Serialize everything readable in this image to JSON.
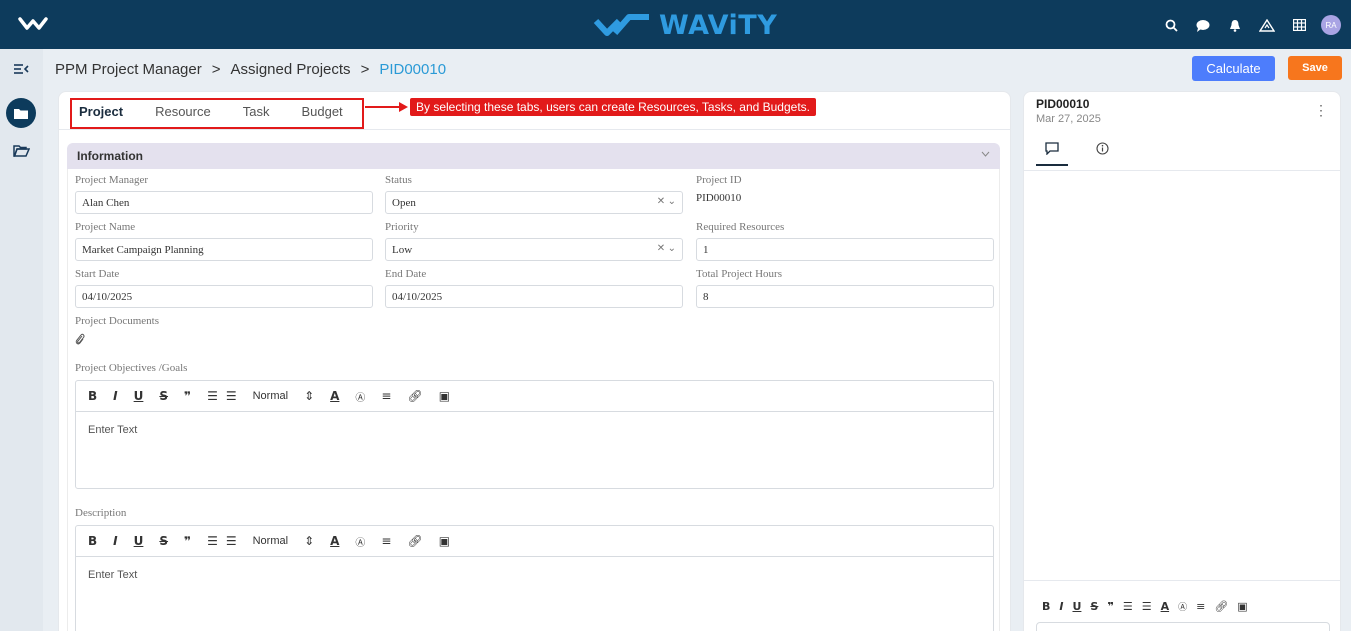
{
  "topbar": {
    "brand": "WAViTY",
    "avatar": "RA",
    "icons": [
      "search-icon",
      "chat-icon",
      "bell-icon",
      "triangle-logo-icon",
      "grid-icon"
    ]
  },
  "breadcrumb": {
    "items": [
      "PPM Project Manager",
      "Assigned Projects",
      "PID00010"
    ],
    "separator": ">"
  },
  "actions": {
    "calculate": "Calculate",
    "save": "Save"
  },
  "tabs": [
    "Project",
    "Resource",
    "Task",
    "Budget"
  ],
  "callout": "By selecting these tabs, users can create Resources, Tasks, and Budgets.",
  "section": {
    "title": "Information",
    "fields": {
      "project_manager": {
        "label": "Project Manager",
        "value": "Alan Chen"
      },
      "status": {
        "label": "Status",
        "value": "Open"
      },
      "project_id": {
        "label": "Project ID",
        "value": "PID00010"
      },
      "project_name": {
        "label": "Project Name",
        "value": "Market Campaign Planning"
      },
      "priority": {
        "label": "Priority",
        "value": "Low"
      },
      "required_resources": {
        "label": "Required Resources",
        "value": "1"
      },
      "start_date": {
        "label": "Start Date",
        "value": "04/10/2025"
      },
      "end_date": {
        "label": "End Date",
        "value": "04/10/2025"
      },
      "total_hours": {
        "label": "Total Project Hours",
        "value": "8"
      },
      "documents": {
        "label": "Project Documents"
      },
      "objectives": {
        "label": "Project Objectives /Goals",
        "placeholder": "Enter Text"
      },
      "description": {
        "label": "Description",
        "placeholder": "Enter Text"
      }
    },
    "toolbar": {
      "format": "Normal"
    }
  },
  "side_panel": {
    "title": "PID00010",
    "date": "Mar 27, 2025",
    "more": "⋮"
  }
}
